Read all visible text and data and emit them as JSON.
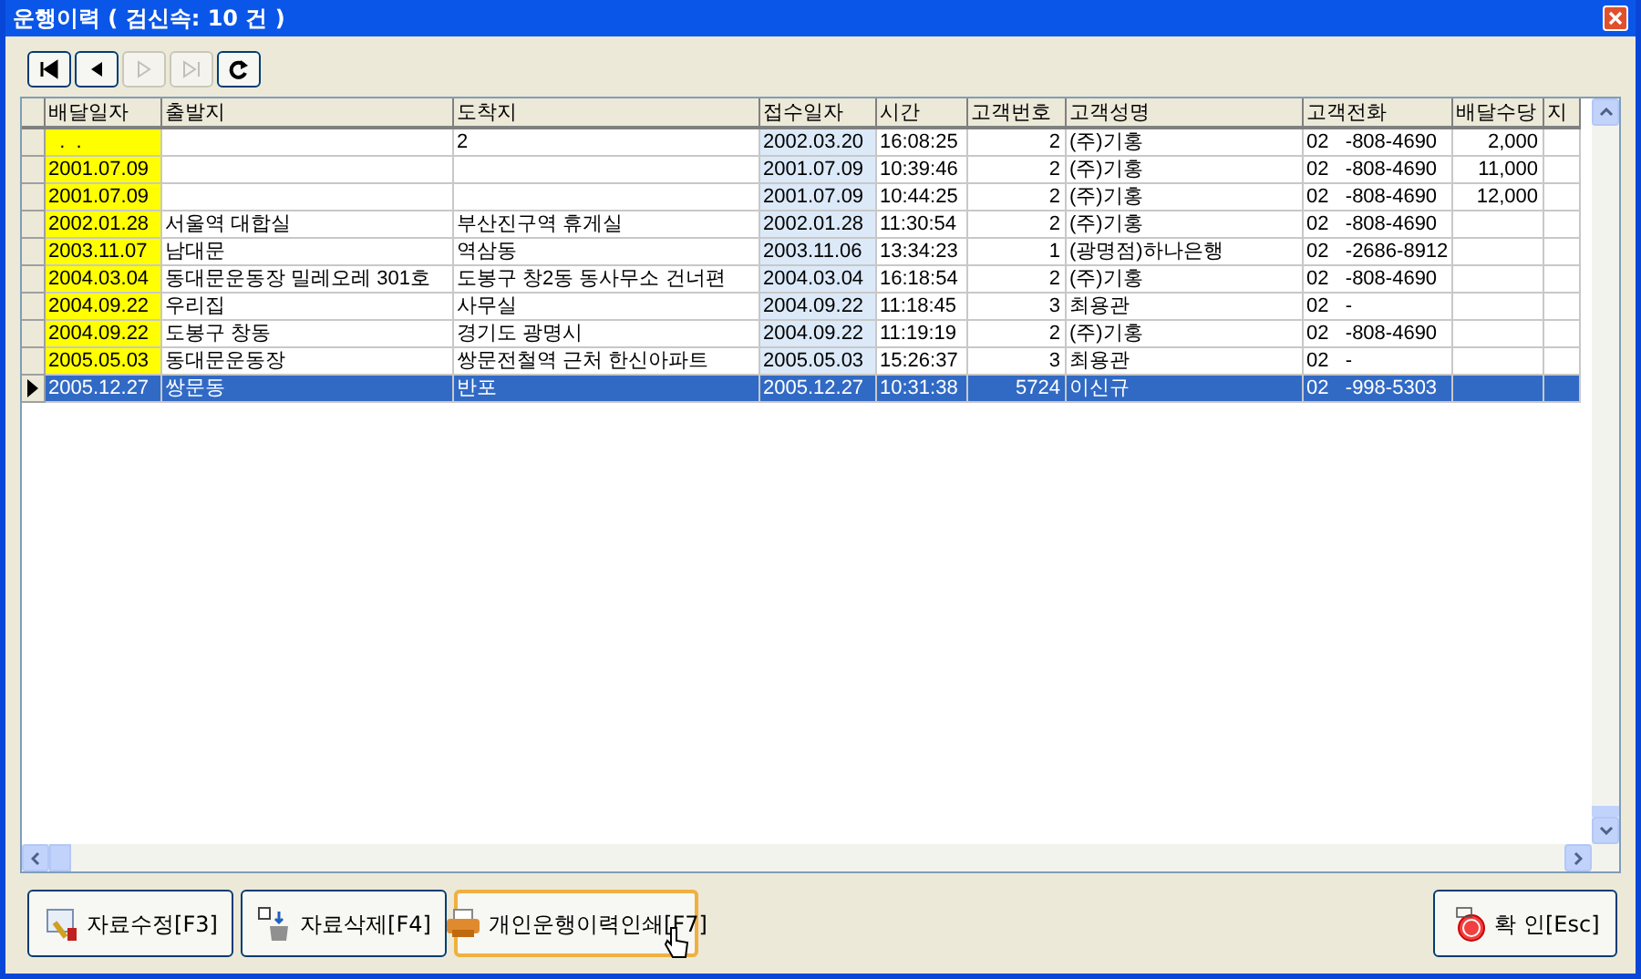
{
  "window": {
    "title": "운행이력 ( 검신속: 10 건 )"
  },
  "nav_buttons": [
    {
      "kind": "first",
      "disabled": false
    },
    {
      "kind": "prev",
      "disabled": false
    },
    {
      "kind": "next",
      "disabled": true
    },
    {
      "kind": "last",
      "disabled": true
    },
    {
      "kind": "refresh",
      "disabled": false
    }
  ],
  "table": {
    "columns": [
      {
        "label": "배달일자",
        "kind": "text",
        "color": "#ffff00"
      },
      {
        "label": "출발지",
        "kind": "text"
      },
      {
        "label": "도착지",
        "kind": "text"
      },
      {
        "label": "접수일자",
        "kind": "text",
        "color": "#dce9f8"
      },
      {
        "label": "시간",
        "kind": "text"
      },
      {
        "label": "고객번호",
        "kind": "number"
      },
      {
        "label": "고객성명",
        "kind": "text"
      },
      {
        "label": "고객전화",
        "kind": "text"
      },
      {
        "label": "배달수당",
        "kind": "number"
      },
      {
        "label": "지",
        "kind": "text"
      }
    ],
    "rows": [
      {
        "selected": false,
        "cells": [
          "  .  .",
          "",
          "2",
          "2002.03.20",
          "16:08:25",
          "2",
          "(주)기홍",
          "02   -808-4690",
          "2,000",
          ""
        ]
      },
      {
        "selected": false,
        "cells": [
          "2001.07.09",
          "",
          "",
          "2001.07.09",
          "10:39:46",
          "2",
          "(주)기홍",
          "02   -808-4690",
          "11,000",
          ""
        ]
      },
      {
        "selected": false,
        "cells": [
          "2001.07.09",
          "",
          "",
          "2001.07.09",
          "10:44:25",
          "2",
          "(주)기홍",
          "02   -808-4690",
          "12,000",
          ""
        ]
      },
      {
        "selected": false,
        "cells": [
          "2002.01.28",
          "서울역 대합실",
          "부산진구역 휴게실",
          "2002.01.28",
          "11:30:54",
          "2",
          "(주)기홍",
          "02   -808-4690",
          "",
          ""
        ]
      },
      {
        "selected": false,
        "cells": [
          "2003.11.07",
          "남대문",
          "역삼동",
          "2003.11.06",
          "13:34:23",
          "1",
          "(광명점)하나은행",
          "02   -2686-8912",
          "",
          ""
        ]
      },
      {
        "selected": false,
        "cells": [
          "2004.03.04",
          "동대문운동장 밀레오레 301호",
          "도봉구 창2동 동사무소 건너편",
          "2004.03.04",
          "16:18:54",
          "2",
          "(주)기홍",
          "02   -808-4690",
          "",
          ""
        ]
      },
      {
        "selected": false,
        "cells": [
          "2004.09.22",
          "우리집",
          "사무실",
          "2004.09.22",
          "11:18:45",
          "3",
          "최용관",
          "02   -",
          "",
          ""
        ]
      },
      {
        "selected": false,
        "cells": [
          "2004.09.22",
          "도봉구 창동",
          "경기도 광명시",
          "2004.09.22",
          "11:19:19",
          "2",
          "(주)기홍",
          "02   -808-4690",
          "",
          ""
        ]
      },
      {
        "selected": false,
        "cells": [
          "2005.05.03",
          "동대문운동장",
          "쌍문전철역 근처 한신아파트",
          "2005.05.03",
          "15:26:37",
          "3",
          "최용관",
          "02   -",
          "",
          ""
        ]
      },
      {
        "selected": true,
        "cells": [
          "2005.12.27",
          "쌍문동",
          "반포",
          "2005.12.27",
          "10:31:38",
          "5724",
          "이신규",
          "02   -998-5303",
          "",
          ""
        ]
      }
    ]
  },
  "buttons": [
    {
      "kind": "edit",
      "label": "자료수정[F3]",
      "focused": false
    },
    {
      "kind": "delete",
      "label": "자료삭제[F4]",
      "focused": false
    },
    {
      "kind": "print",
      "label": "개인운행이력인쇄[F7]",
      "focused": true
    },
    {
      "kind": "confirm",
      "label": "확 인[Esc]",
      "focused": false
    }
  ]
}
